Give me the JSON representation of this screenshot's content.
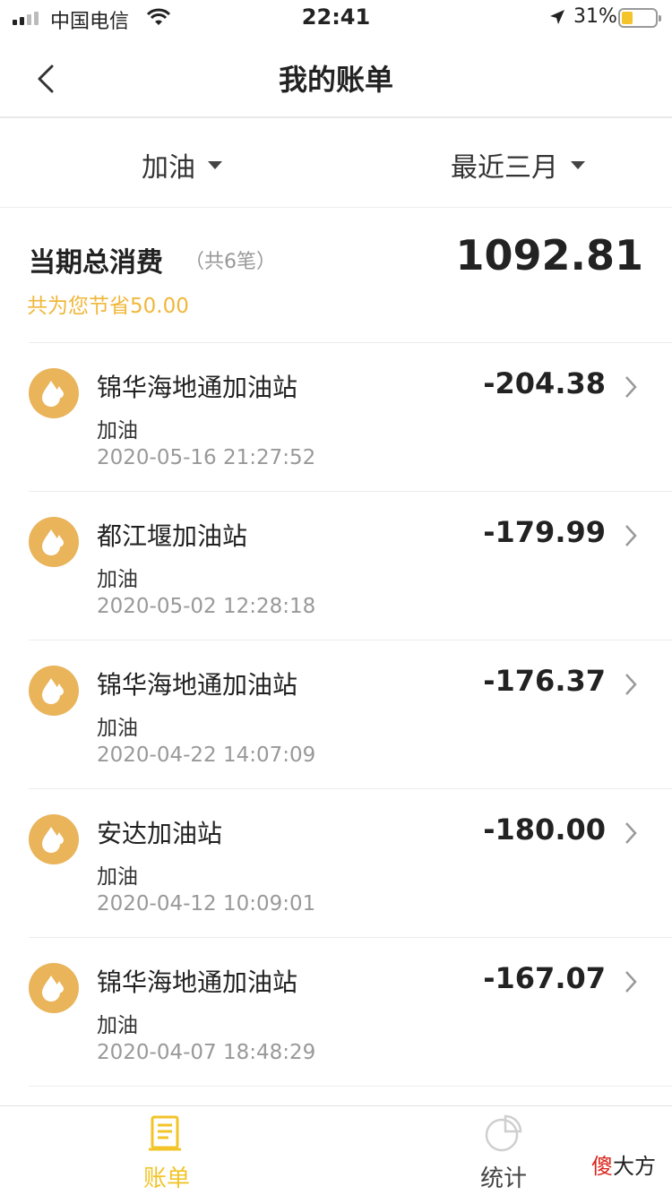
{
  "status_bar": {
    "carrier": "中国电信",
    "time": "22:41",
    "battery": "31%"
  },
  "nav": {
    "title": "我的账单"
  },
  "filters": {
    "type": "加油",
    "range": "最近三月"
  },
  "summary": {
    "label": "当期总消费",
    "count": "（共6笔）",
    "total": "1092.81",
    "saved": "共为您节省50.00"
  },
  "transactions": [
    {
      "name": "锦华海地通加油站",
      "category": "加油",
      "time": "2020-05-16 21:27:52",
      "amount": "-204.38"
    },
    {
      "name": "都江堰加油站",
      "category": "加油",
      "time": "2020-05-02 12:28:18",
      "amount": "-179.99"
    },
    {
      "name": "锦华海地通加油站",
      "category": "加油",
      "time": "2020-04-22 14:07:09",
      "amount": "-176.37"
    },
    {
      "name": "安达加油站",
      "category": "加油",
      "time": "2020-04-12 10:09:01",
      "amount": "-180.00"
    },
    {
      "name": "锦华海地通加油站",
      "category": "加油",
      "time": "2020-04-07 18:48:29",
      "amount": "-167.07"
    }
  ],
  "tabs": {
    "bill": "账单",
    "stats": "统计"
  },
  "watermark": {
    "red": "傻",
    "rest": "大方"
  },
  "icons": {
    "back": "chevron-left-icon",
    "transaction": "oil-drop-icon",
    "row_arrow": "chevron-right-icon",
    "bill_tab": "bill-list-icon",
    "stats_tab": "pie-chart-icon"
  },
  "colors": {
    "accent": "#f2c428",
    "saved_text": "#f0b73a",
    "icon_bg": "#e9b45a"
  }
}
